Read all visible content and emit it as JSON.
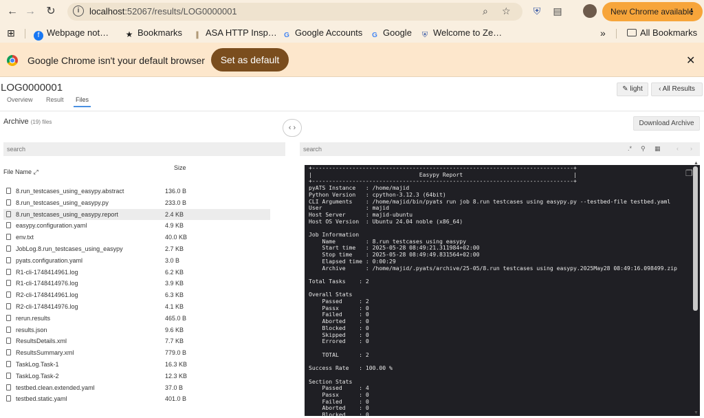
{
  "browser": {
    "url_host": "localhost",
    "url_rest": ":52067/results/LOG0000001",
    "update_label": "New Chrome available",
    "bookmarks": [
      {
        "label": "Webpage not…",
        "icon": "facebook-icon"
      },
      {
        "label": "Bookmarks",
        "icon": "star-icon"
      },
      {
        "label": "ASA HTTP Insp…",
        "icon": "bookmark-icon"
      },
      {
        "label": "Google Accounts",
        "icon": "google-icon"
      },
      {
        "label": "Google",
        "icon": "google-icon"
      },
      {
        "label": "Welcome to Ze…",
        "icon": "shield-icon"
      }
    ],
    "all_bookmarks": "All Bookmarks",
    "infobar_text": "Google Chrome isn't your default browser",
    "infobar_button": "Set as default"
  },
  "app": {
    "title": "LOG0000001",
    "tabs": [
      "Overview",
      "Result",
      "Files"
    ],
    "active_tab": "Files",
    "light_label": "light",
    "all_results_label": "All Results",
    "archive_label": "Archive",
    "archive_count": "(19) files",
    "download_label": "Download Archive",
    "search_placeholder": "search",
    "col_name": "File Name",
    "col_size": "Size",
    "files": [
      {
        "name": "8.run_testcases_using_easypy.abstract",
        "size": "136.0 B"
      },
      {
        "name": "8.run_testcases_using_easypy.py",
        "size": "233.0 B"
      },
      {
        "name": "8.run_testcases_using_easypy.report",
        "size": "2.4 KB"
      },
      {
        "name": "easypy.configuration.yaml",
        "size": "4.9 KB"
      },
      {
        "name": "env.txt",
        "size": "40.0 KB"
      },
      {
        "name": "JobLog.8.run_testcases_using_easypy",
        "size": "2.7 KB"
      },
      {
        "name": "pyats.configuration.yaml",
        "size": "3.0 B"
      },
      {
        "name": "R1-cli-1748414961.log",
        "size": "6.2 KB"
      },
      {
        "name": "R1-cli-1748414976.log",
        "size": "3.9 KB"
      },
      {
        "name": "R2-cli-1748414961.log",
        "size": "6.3 KB"
      },
      {
        "name": "R2-cli-1748414976.log",
        "size": "4.1 KB"
      },
      {
        "name": "rerun.results",
        "size": "465.0 B"
      },
      {
        "name": "results.json",
        "size": "9.6 KB"
      },
      {
        "name": "ResultsDetails.xml",
        "size": "7.7 KB"
      },
      {
        "name": "ResultsSummary.xml",
        "size": "779.0 B"
      },
      {
        "name": "TaskLog.Task-1",
        "size": "16.3 KB"
      },
      {
        "name": "TaskLog.Task-2",
        "size": "12.3 KB"
      },
      {
        "name": "testbed.clean.extended.yaml",
        "size": "37.0 B"
      },
      {
        "name": "testbed.static.yaml",
        "size": "401.0 B"
      }
    ],
    "selected_file": "8.run_testcases_using_easypy.report",
    "report_text": "+------------------------------------------------------------------------------+\n|                                Easypy Report                                 |\n+------------------------------------------------------------------------------+\npyATS Instance   : /home/majid\nPython Version   : cpython-3.12.3 (64bit)\nCLI Arguments    : /home/majid/bin/pyats run job 8.run testcases using easypy.py --testbed-file testbed.yaml\nUser             : majid\nHost Server      : majid-ubuntu\nHost OS Version  : Ubuntu 24.04 noble (x86_64)\n\nJob Information\n    Name         : 8.run testcases using easypy\n    Start time   : 2025-05-28 08:49:21.311984+02:00\n    Stop time    : 2025-05-28 08:49:49.831564+02:00\n    Elapsed time : 0:00:29\n    Archive      : /home/majid/.pyats/archive/25-05/8.run testcases using easypy.2025May28 08:49:16.098499.zip\n\nTotal Tasks    : 2\n\nOverall Stats\n    Passed     : 2\n    Passx      : 0\n    Failed     : 0\n    Aborted    : 0\n    Blocked    : 0\n    Skipped    : 0\n    Errored    : 0\n\n    TOTAL      : 2\n\nSuccess Rate   : 100.00 %\n\nSection Stats\n    Passed     : 4\n    Passx      : 0\n    Failed     : 0\n    Aborted    : 0\n    Blocked    : 0"
  }
}
